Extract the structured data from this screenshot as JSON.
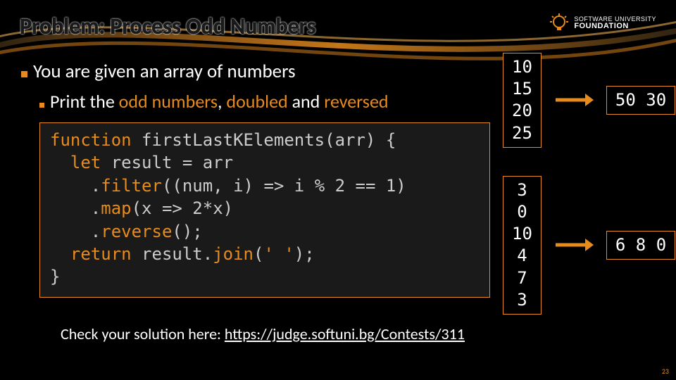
{
  "title": "Problem: Process Odd Numbers",
  "logo": {
    "line1": "SOFTWARE UNIVERSITY",
    "line2": "FOUNDATION"
  },
  "bullets": {
    "main": "You are given an array of numbers",
    "sub_prefix": "Print the ",
    "sub_hl1": "odd numbers",
    "sub_mid": ", ",
    "sub_hl2": "doubled",
    "sub_mid2": " and ",
    "sub_hl3": "reversed"
  },
  "code": {
    "l1a": "function",
    "l1b": " firstLastKElements(arr) {",
    "l2a": "  let",
    "l2b": " result = arr",
    "l3a": "    .",
    "l3b": "filter",
    "l3c": "((num, i) => i % 2 == 1)",
    "l4a": "    .",
    "l4b": "map",
    "l4c": "(x => 2*x)",
    "l5a": "    .",
    "l5b": "reverse",
    "l5c": "();",
    "l6a": "  return",
    "l6b": " result.",
    "l6c": "join",
    "l6d": "(",
    "l6e": "' '",
    "l6f": ");",
    "l7": "}"
  },
  "examples": [
    {
      "input": "10\n15\n20\n25",
      "output": "50 30"
    },
    {
      "input": "3\n0\n10\n4\n7\n3",
      "output": "6 8 0"
    }
  ],
  "check": {
    "prefix": "Check your solution here: ",
    "url": "https://judge.softuni.bg/Contests/311"
  },
  "page_number": "23"
}
